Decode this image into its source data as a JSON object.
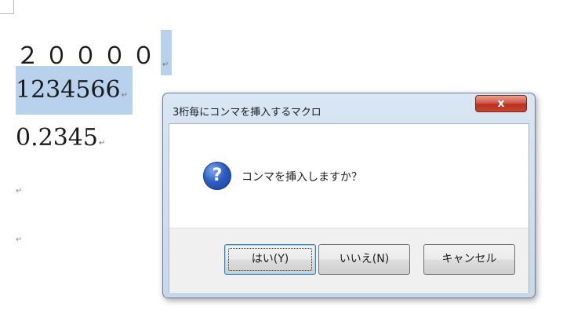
{
  "document": {
    "line1": "２００００",
    "line2": "1234566",
    "line3": "0.2345",
    "paragraph_mark": "↵"
  },
  "dialog": {
    "title": "3桁毎にコンマを挿入するマクロ",
    "close_label": "x",
    "icon": "question-icon",
    "icon_glyph": "?",
    "message": "コンマを挿入しますか？",
    "buttons": {
      "yes": "はい(Y)",
      "no": "いいえ(N)",
      "cancel": "キャンセル"
    }
  },
  "colors": {
    "selection": "#b8d2ee",
    "close_button": "#c9452f",
    "icon_blue": "#2d5fc1"
  }
}
